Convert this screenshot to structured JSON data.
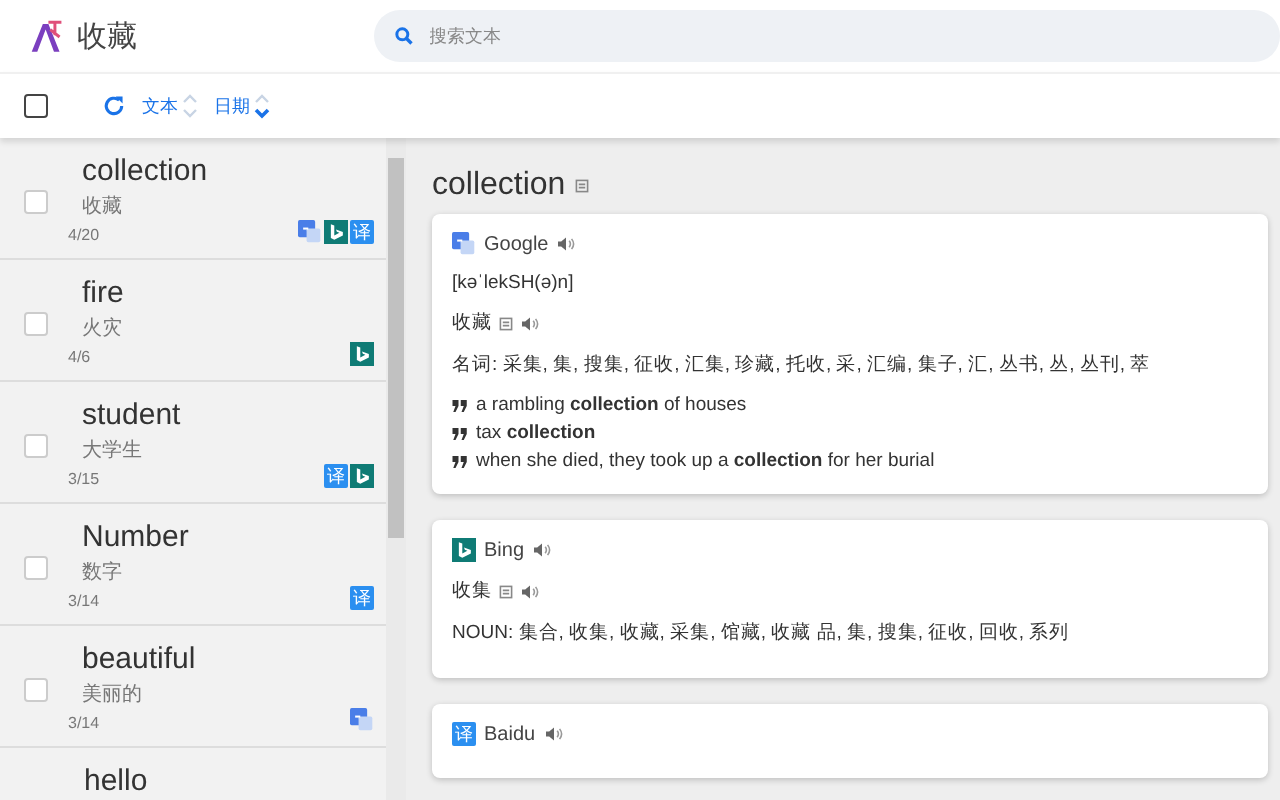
{
  "header": {
    "title": "收藏",
    "search": {
      "placeholder": "搜索文本"
    }
  },
  "toolbar": {
    "select_all": {
      "checked": false
    },
    "sort_fields": [
      {
        "label": "文本",
        "descending": false
      },
      {
        "label": "日期",
        "descending": true
      }
    ]
  },
  "list": [
    {
      "word": "collection",
      "translation": "收藏",
      "count": "4/20",
      "checked": false,
      "badges": [
        {
          "kind": "google"
        },
        {
          "kind": "bing"
        },
        {
          "kind": "baidu",
          "glyph": "译"
        }
      ]
    },
    {
      "word": "fire",
      "translation": "火灾",
      "count": "4/6",
      "checked": false,
      "badges": [
        {
          "kind": "bing"
        }
      ]
    },
    {
      "word": "student",
      "translation": "大学生",
      "count": "3/15",
      "checked": false,
      "badges": [
        {
          "kind": "baidu",
          "glyph": "译"
        },
        {
          "kind": "bing"
        }
      ]
    },
    {
      "word": "Number",
      "translation": "数字",
      "count": "3/14",
      "checked": false,
      "badges": [
        {
          "kind": "baidu",
          "glyph": "译"
        }
      ]
    },
    {
      "word": "beautiful",
      "translation": "美丽的",
      "count": "3/14",
      "checked": false,
      "badges": [
        {
          "kind": "google"
        }
      ]
    },
    {
      "word": "hello"
    }
  ],
  "detail": {
    "title": "collection",
    "cards": [
      {
        "kind": "google",
        "name": "Google",
        "phonetic": "[kəˈlekSH(ə)n]",
        "translation": "收藏",
        "explains": [
          "名词: 采集, 集, 搜集, 征收, 汇集, 珍藏, 托收, 采, 汇编, 集子, 汇, 丛书, 丛, 丛刊, 萃"
        ],
        "examples": [
          "a rambling **collection** of houses",
          "tax **collection**",
          "when she died, they took up a **collection** for her burial"
        ]
      },
      {
        "kind": "bing",
        "name": "Bing",
        "translation": "收集",
        "explains": [
          "NOUN: 集合, 收集, 收藏, 采集, 馆藏, 收藏 品, 集, 搜集, 征收, 回收, 系列"
        ]
      },
      {
        "kind": "baidu",
        "name": "Baidu",
        "glyph": "译"
      }
    ]
  }
}
